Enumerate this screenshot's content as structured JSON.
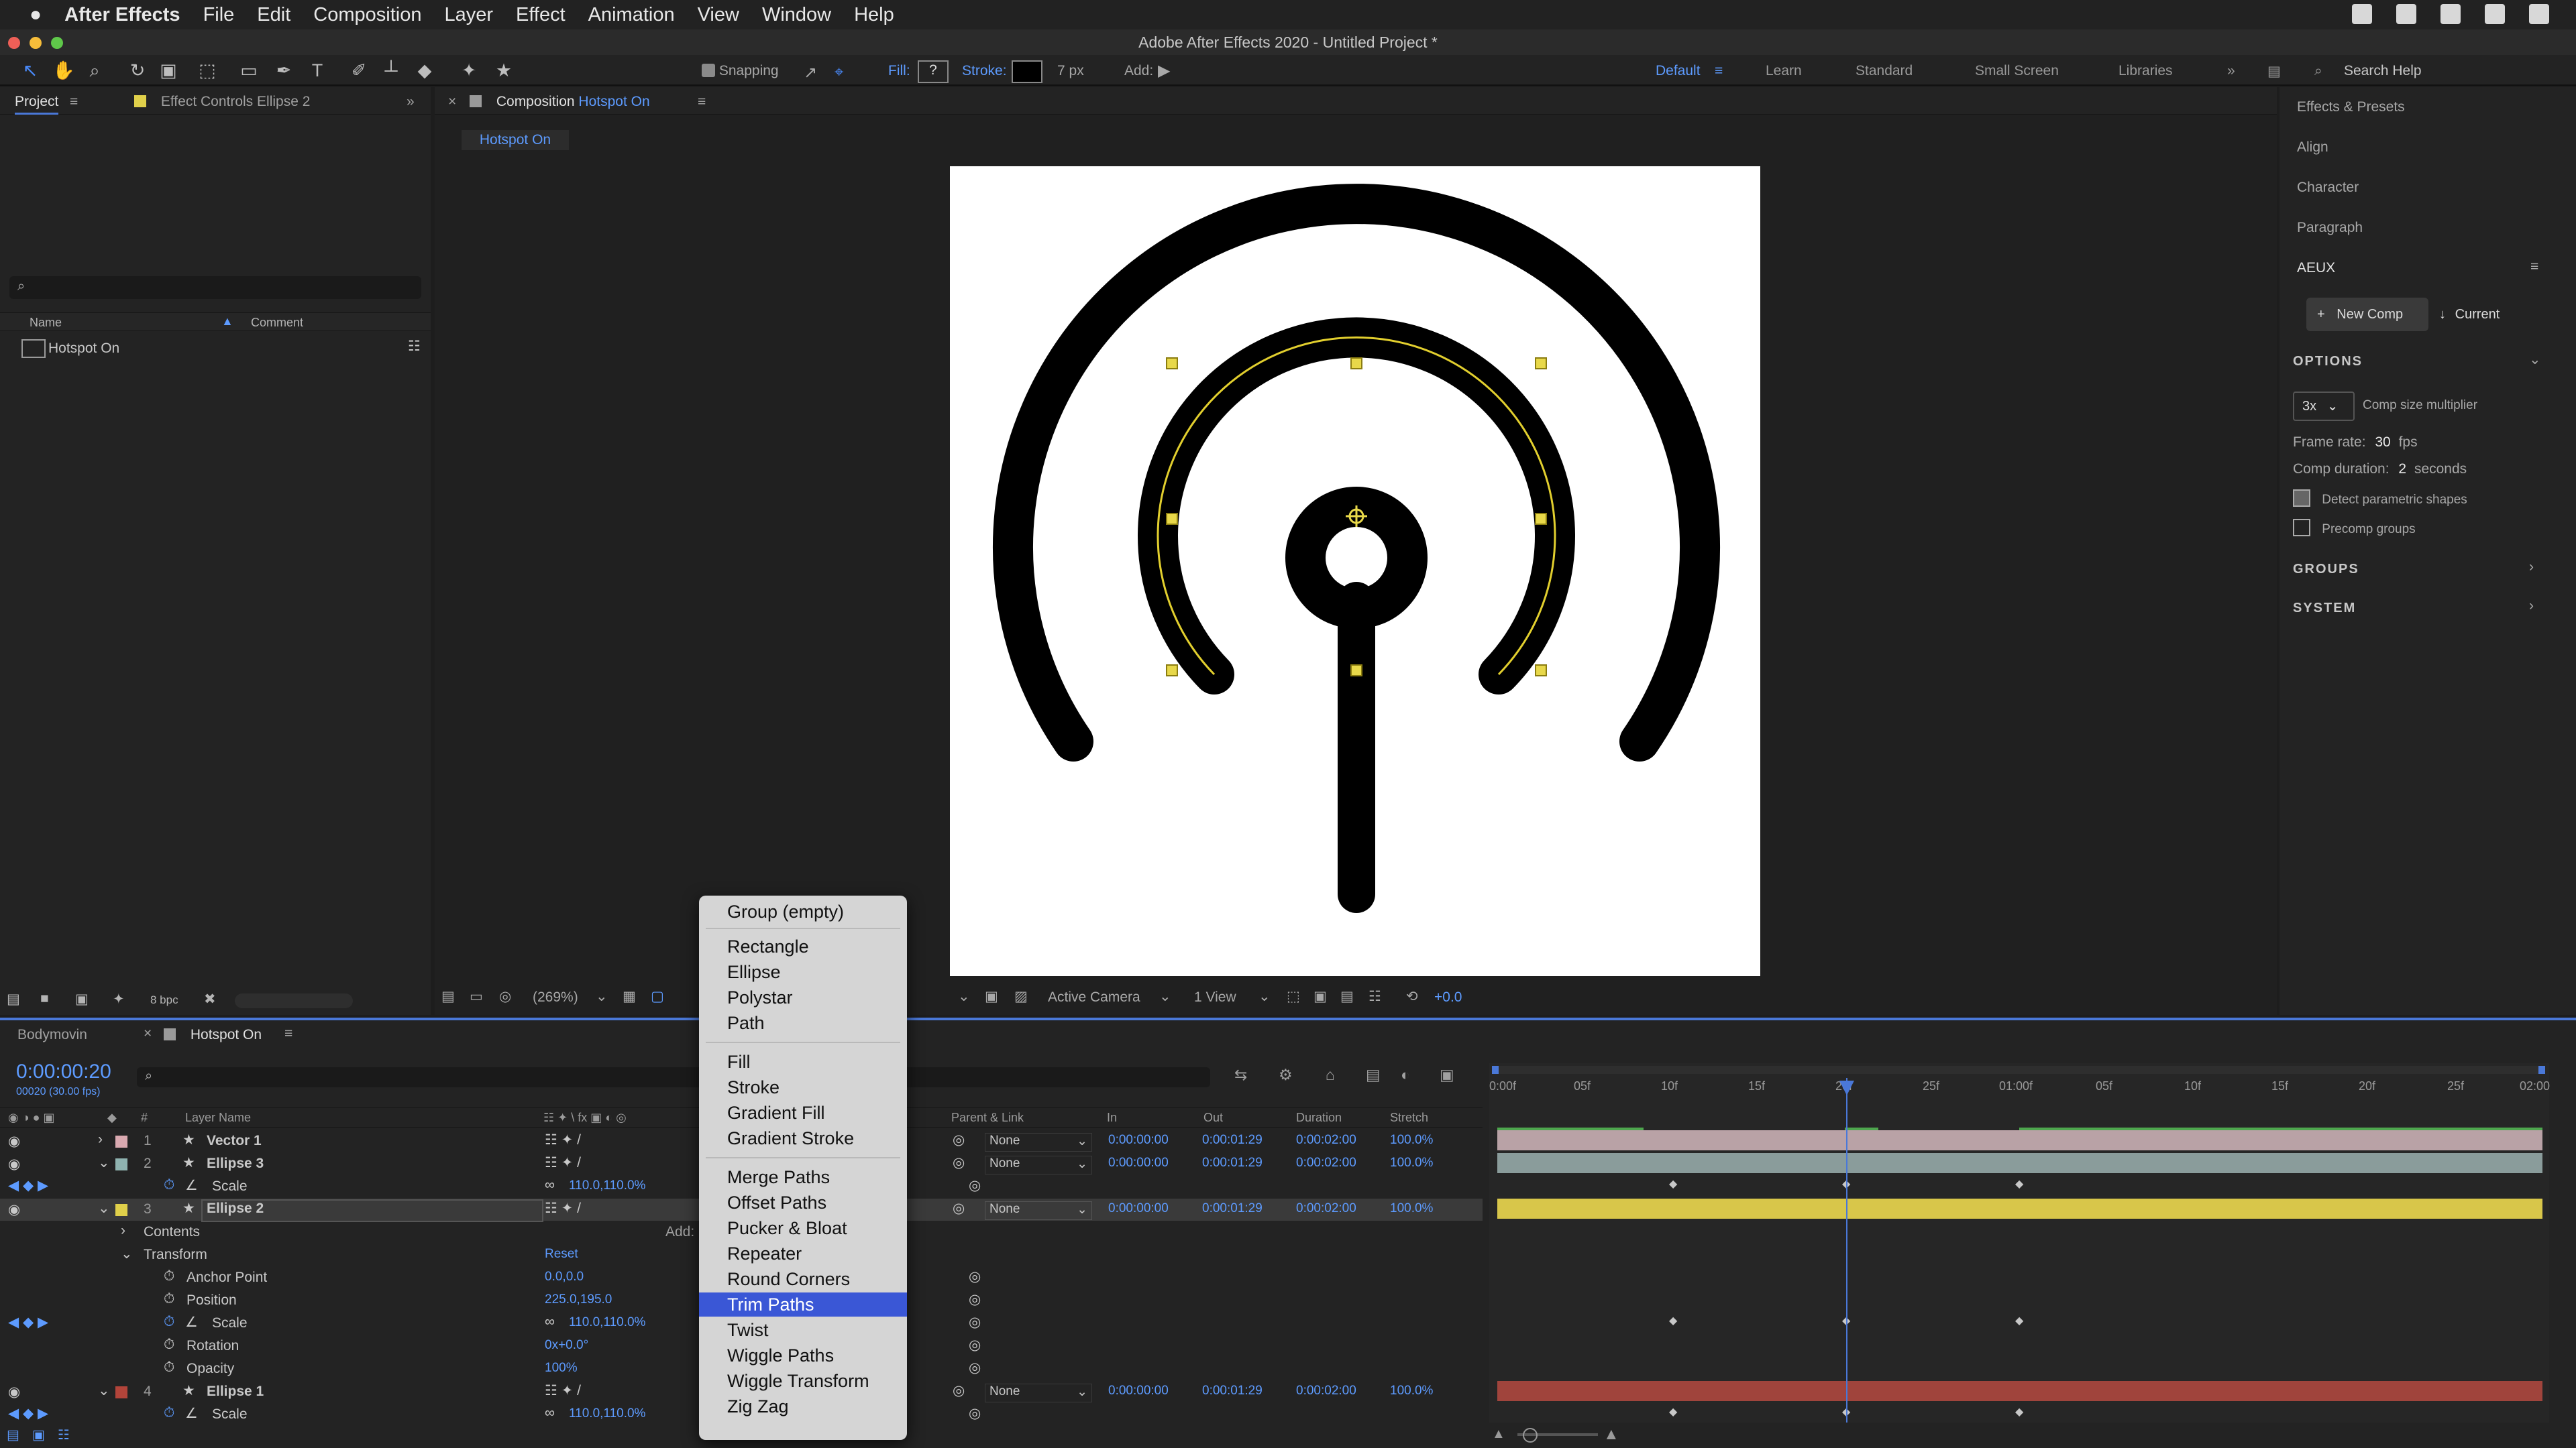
{
  "menubar": {
    "app": "After Effects",
    "items": [
      "File",
      "Edit",
      "Composition",
      "Layer",
      "Effect",
      "Animation",
      "View",
      "Window",
      "Help"
    ]
  },
  "window": {
    "title": "Adobe After Effects 2020 - Untitled Project *"
  },
  "toolbar": {
    "snapping_label": "Snapping",
    "fill_label": "Fill:",
    "fill_value": "?",
    "stroke_label": "Stroke:",
    "stroke_width": "7 px",
    "add_label": "Add:",
    "workspaces": [
      "Default",
      "Learn",
      "Standard",
      "Small Screen",
      "Libraries"
    ],
    "search_placeholder": "Search Help"
  },
  "project_panel": {
    "tabs": [
      "Project",
      "Effect Controls Ellipse 2"
    ],
    "col_name": "Name",
    "col_comment": "Comment",
    "items": [
      "Hotspot On"
    ],
    "bpc": "8 bpc"
  },
  "comp_panel": {
    "tab_prefix": "Composition",
    "tab_name": "Hotspot On",
    "breadcrumb": "Hotspot On",
    "zoom": "(269%)",
    "camera": "Active Camera",
    "views": "1 View",
    "exposure": "+0.0"
  },
  "right_panel": {
    "items": [
      "Effects & Presets",
      "Align",
      "Character",
      "Paragraph"
    ],
    "aeux": "AEUX",
    "new_comp": "New Comp",
    "current": "Current",
    "options_label": "OPTIONS",
    "multiplier_value": "3x",
    "multiplier_label": "Comp size multiplier",
    "frame_rate_label": "Frame rate:",
    "frame_rate_value": "30",
    "frame_rate_unit": "fps",
    "duration_label": "Comp duration:",
    "duration_value": "2",
    "duration_unit": "seconds",
    "detect_label": "Detect parametric shapes",
    "precomp_label": "Precomp groups",
    "groups_label": "GROUPS",
    "system_label": "SYSTEM"
  },
  "timeline": {
    "tabs": [
      "Bodymovin",
      "Hotspot On"
    ],
    "timecode": "0:00:00:20",
    "frames": "00020 (30.00 fps)",
    "col_layer_name": "Layer Name",
    "col_parent": "Parent & Link",
    "col_in": "In",
    "col_out": "Out",
    "col_duration": "Duration",
    "col_stretch": "Stretch",
    "ruler": [
      "0:00f",
      "05f",
      "10f",
      "15f",
      "20f",
      "25f",
      "01:00f",
      "05f",
      "10f",
      "15f",
      "20f",
      "25f",
      "02:00"
    ],
    "layers": [
      {
        "num": "1",
        "name": "Vector 1",
        "parent": "None",
        "in": "0:00:00:00",
        "out": "0:00:01:29",
        "dur": "0:00:02:00",
        "stretch": "100.0%"
      },
      {
        "num": "2",
        "name": "Ellipse 3",
        "parent": "None",
        "in": "0:00:00:00",
        "out": "0:00:01:29",
        "dur": "0:00:02:00",
        "stretch": "100.0%"
      },
      {
        "num": "3",
        "name": "Ellipse 2",
        "parent": "None",
        "in": "0:00:00:00",
        "out": "0:00:01:29",
        "dur": "0:00:02:00",
        "stretch": "100.0%"
      },
      {
        "num": "4",
        "name": "Ellipse 1",
        "parent": "None",
        "in": "0:00:00:00",
        "out": "0:00:01:29",
        "dur": "0:00:02:00",
        "stretch": "100.0%"
      }
    ],
    "scale_label": "Scale",
    "scale_value": "110.0,110.0%",
    "contents_label": "Contents",
    "add_label": "Add:",
    "transform_label": "Transform",
    "reset_label": "Reset",
    "props": [
      {
        "name": "Anchor Point",
        "value": "0.0,0.0"
      },
      {
        "name": "Position",
        "value": "225.0,195.0"
      },
      {
        "name": "Scale",
        "value": "110.0,110.0%"
      },
      {
        "name": "Rotation",
        "value": "0x+0.0°"
      },
      {
        "name": "Opacity",
        "value": "100%"
      }
    ]
  },
  "context_menu": {
    "items": [
      "Group (empty)",
      "Rectangle",
      "Ellipse",
      "Polystar",
      "Path",
      "Fill",
      "Stroke",
      "Gradient Fill",
      "Gradient Stroke",
      "Merge Paths",
      "Offset Paths",
      "Pucker & Bloat",
      "Repeater",
      "Round Corners",
      "Trim Paths",
      "Twist",
      "Wiggle Paths",
      "Wiggle Transform",
      "Zig Zag"
    ],
    "selected": "Trim Paths"
  },
  "colors": {
    "accent_blue": "#4a78d8",
    "label_pink": "#d9a9b0",
    "label_teal": "#8fb3b0",
    "label_yellow": "#e0d04a",
    "label_red": "#b2443a"
  }
}
